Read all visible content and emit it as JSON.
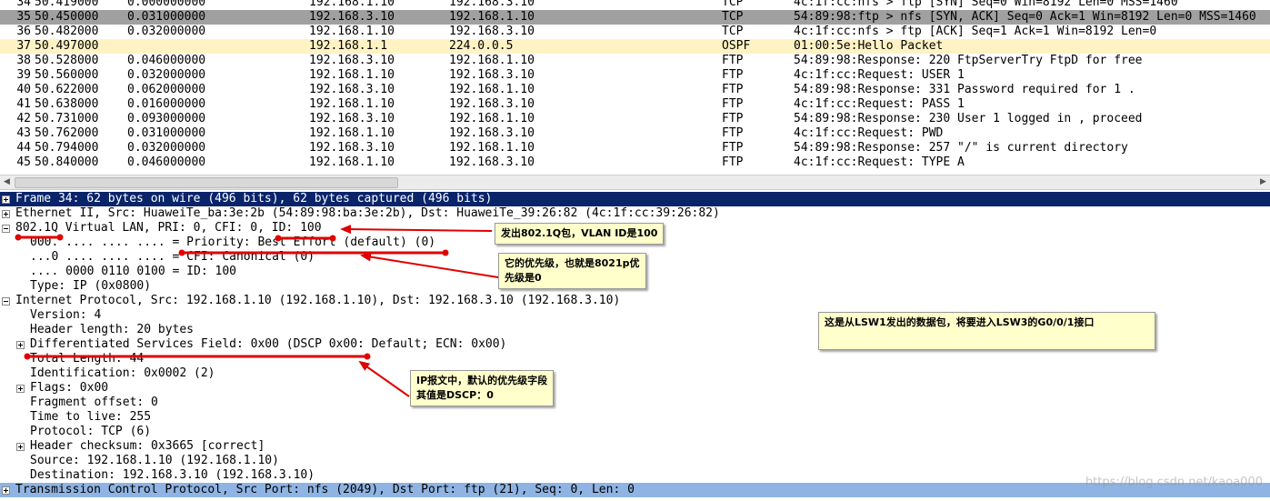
{
  "packets": [
    {
      "no": "34",
      "time": "50.419000",
      "delta": "0.000000000",
      "src": "192.168.1.10",
      "dst": "192.168.3.10",
      "proto": "TCP",
      "info": "4c:1f:cc:nfs > ftp [SYN] Seq=0 Win=8192 Len=0 MSS=1460",
      "bg": "#ffffff",
      "fg": "#000000"
    },
    {
      "no": "35",
      "time": "50.450000",
      "delta": "0.031000000",
      "src": "192.168.3.10",
      "dst": "192.168.1.10",
      "proto": "TCP",
      "info": "54:89:98:ftp > nfs [SYN, ACK] Seq=0 Ack=1 Win=8192 Len=0 MSS=1460",
      "bg": "#a0a0a0",
      "fg": "#000000"
    },
    {
      "no": "36",
      "time": "50.482000",
      "delta": "0.032000000",
      "src": "192.168.1.10",
      "dst": "192.168.3.10",
      "proto": "TCP",
      "info": "4c:1f:cc:nfs > ftp [ACK] Seq=1 Ack=1 Win=8192 Len=0",
      "bg": "#ffffff",
      "fg": "#000000"
    },
    {
      "no": "37",
      "time": "50.497000",
      "delta": "",
      "src": "192.168.1.1",
      "dst": "224.0.0.5",
      "proto": "OSPF",
      "info": "01:00:5e:Hello Packet",
      "bg": "#fff3c4",
      "fg": "#000000"
    },
    {
      "no": "38",
      "time": "50.528000",
      "delta": "0.046000000",
      "src": "192.168.3.10",
      "dst": "192.168.1.10",
      "proto": "FTP",
      "info": "54:89:98:Response: 220 FtpServerTry FtpD for free",
      "bg": "#ffffff",
      "fg": "#000000"
    },
    {
      "no": "39",
      "time": "50.560000",
      "delta": "0.032000000",
      "src": "192.168.1.10",
      "dst": "192.168.3.10",
      "proto": "FTP",
      "info": "4c:1f:cc:Request: USER 1",
      "bg": "#ffffff",
      "fg": "#000000"
    },
    {
      "no": "40",
      "time": "50.622000",
      "delta": "0.062000000",
      "src": "192.168.3.10",
      "dst": "192.168.1.10",
      "proto": "FTP",
      "info": "54:89:98:Response: 331 Password required for 1 .",
      "bg": "#ffffff",
      "fg": "#000000"
    },
    {
      "no": "41",
      "time": "50.638000",
      "delta": "0.016000000",
      "src": "192.168.1.10",
      "dst": "192.168.3.10",
      "proto": "FTP",
      "info": "4c:1f:cc:Request: PASS 1",
      "bg": "#ffffff",
      "fg": "#000000"
    },
    {
      "no": "42",
      "time": "50.731000",
      "delta": "0.093000000",
      "src": "192.168.3.10",
      "dst": "192.168.1.10",
      "proto": "FTP",
      "info": "54:89:98:Response: 230 User 1 logged in , proceed",
      "bg": "#ffffff",
      "fg": "#000000"
    },
    {
      "no": "43",
      "time": "50.762000",
      "delta": "0.031000000",
      "src": "192.168.1.10",
      "dst": "192.168.3.10",
      "proto": "FTP",
      "info": "4c:1f:cc:Request: PWD",
      "bg": "#ffffff",
      "fg": "#000000"
    },
    {
      "no": "44",
      "time": "50.794000",
      "delta": "0.032000000",
      "src": "192.168.3.10",
      "dst": "192.168.1.10",
      "proto": "FTP",
      "info": "54:89:98:Response: 257 \"/\" is current directory",
      "bg": "#ffffff",
      "fg": "#000000"
    },
    {
      "no": "45",
      "time": "50.840000",
      "delta": "0.046000000",
      "src": "192.168.1.10",
      "dst": "192.168.3.10",
      "proto": "FTP",
      "info": "4c:1f:cc:Request: TYPE A",
      "bg": "#ffffff",
      "fg": "#000000"
    }
  ],
  "details": [
    {
      "text": "Frame 34: 62 bytes on wire (496 bits), 62 bytes captured (496 bits)",
      "indent": 0,
      "expander": "plus",
      "bg": "#0a246a",
      "fg": "#ffffff"
    },
    {
      "text": "Ethernet II, Src: HuaweiTe_ba:3e:2b (54:89:98:ba:3e:2b), Dst: HuaweiTe_39:26:82 (4c:1f:cc:39:26:82)",
      "indent": 0,
      "expander": "plus",
      "bg": "#ffffff",
      "fg": "#000000"
    },
    {
      "text": "802.1Q Virtual LAN, PRI: 0, CFI: 0, ID: 100",
      "indent": 0,
      "expander": "minus",
      "bg": "#ffffff",
      "fg": "#000000"
    },
    {
      "text": "000. .... .... .... = Priority: Best Effort (default) (0)",
      "indent": 1,
      "expander": "",
      "bg": "#ffffff",
      "fg": "#000000"
    },
    {
      "text": "...0 .... .... .... = CFI: Canonical (0)",
      "indent": 1,
      "expander": "",
      "bg": "#ffffff",
      "fg": "#000000"
    },
    {
      "text": ".... 0000 0110 0100 = ID: 100",
      "indent": 1,
      "expander": "",
      "bg": "#ffffff",
      "fg": "#000000"
    },
    {
      "text": "Type: IP (0x0800)",
      "indent": 1,
      "expander": "",
      "bg": "#ffffff",
      "fg": "#000000"
    },
    {
      "text": "Internet Protocol, Src: 192.168.1.10 (192.168.1.10), Dst: 192.168.3.10 (192.168.3.10)",
      "indent": 0,
      "expander": "minus",
      "bg": "#ffffff",
      "fg": "#000000"
    },
    {
      "text": "Version: 4",
      "indent": 1,
      "expander": "",
      "bg": "#ffffff",
      "fg": "#000000"
    },
    {
      "text": "Header length: 20 bytes",
      "indent": 1,
      "expander": "",
      "bg": "#ffffff",
      "fg": "#000000"
    },
    {
      "text": "Differentiated Services Field: 0x00 (DSCP 0x00: Default; ECN: 0x00)",
      "indent": 1,
      "expander": "plus",
      "bg": "#ffffff",
      "fg": "#000000"
    },
    {
      "text": "Total Length: 44",
      "indent": 1,
      "expander": "",
      "bg": "#ffffff",
      "fg": "#000000"
    },
    {
      "text": "Identification: 0x0002 (2)",
      "indent": 1,
      "expander": "",
      "bg": "#ffffff",
      "fg": "#000000"
    },
    {
      "text": "Flags: 0x00",
      "indent": 1,
      "expander": "plus",
      "bg": "#ffffff",
      "fg": "#000000"
    },
    {
      "text": "Fragment offset: 0",
      "indent": 1,
      "expander": "",
      "bg": "#ffffff",
      "fg": "#000000"
    },
    {
      "text": "Time to live: 255",
      "indent": 1,
      "expander": "",
      "bg": "#ffffff",
      "fg": "#000000"
    },
    {
      "text": "Protocol: TCP (6)",
      "indent": 1,
      "expander": "",
      "bg": "#ffffff",
      "fg": "#000000"
    },
    {
      "text": "Header checksum: 0x3665 [correct]",
      "indent": 1,
      "expander": "plus",
      "bg": "#ffffff",
      "fg": "#000000"
    },
    {
      "text": "Source: 192.168.1.10 (192.168.1.10)",
      "indent": 1,
      "expander": "",
      "bg": "#ffffff",
      "fg": "#000000"
    },
    {
      "text": "Destination: 192.168.3.10 (192.168.3.10)",
      "indent": 1,
      "expander": "",
      "bg": "#ffffff",
      "fg": "#000000"
    },
    {
      "text": "Transmission Control Protocol, Src Port: nfs (2049), Dst Port: ftp (21), Seq: 0, Len: 0",
      "indent": 0,
      "expander": "plus",
      "bg": "#8fb4e3",
      "fg": "#000000"
    }
  ],
  "annotations": {
    "vlan_note": "发出802.1Q包，VLAN ID是100",
    "priority_note": "它的优先级，也就是8021p优\n先级是0",
    "origin_note": "这是从LSW1发出的数据包，将要进入LSW3的G0/0/1接口",
    "dscp_note": "IP报文中，默认的优先级字段\n其值是DSCP：0"
  },
  "watermark": "https://blog.csdn.net/kaoa000",
  "colors": {
    "selected_row": "#a0a0a0",
    "ospf_row": "#fff3c4",
    "selected_detail": "#0a246a",
    "tcp_detail": "#8fb4e3",
    "annotation_red": "#e00000",
    "note_bg": "#ffffcc"
  }
}
